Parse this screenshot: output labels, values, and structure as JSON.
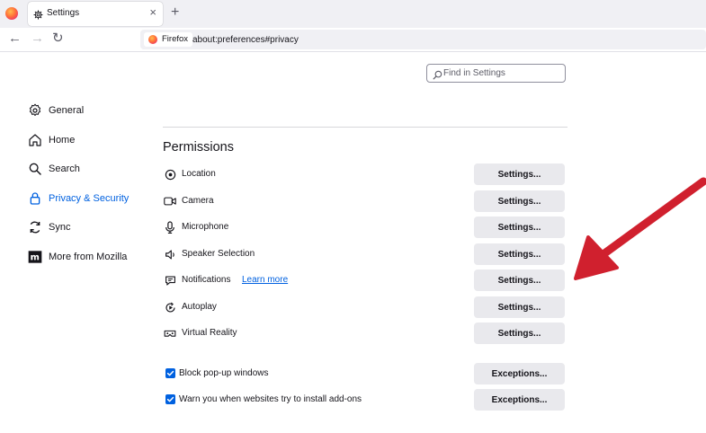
{
  "browser": {
    "tab": {
      "title": "Settings",
      "close_glyph": "×"
    },
    "new_tab_glyph": "+",
    "nav": {
      "back": "←",
      "forward": "→",
      "reload": "↻"
    },
    "identity_label": "Firefox",
    "url": "about:preferences#privacy"
  },
  "search": {
    "placeholder": "Find in Settings",
    "value": ""
  },
  "sidebar": {
    "items": [
      {
        "label": "General",
        "icon": "gear-icon",
        "selected": false
      },
      {
        "label": "Home",
        "icon": "home-icon",
        "selected": false
      },
      {
        "label": "Search",
        "icon": "search-icon",
        "selected": false
      },
      {
        "label": "Privacy & Security",
        "icon": "lock-icon",
        "selected": true
      },
      {
        "label": "Sync",
        "icon": "sync-icon",
        "selected": false
      },
      {
        "label": "More from Mozilla",
        "icon": "mozilla-icon",
        "selected": false
      }
    ]
  },
  "permissions": {
    "title": "Permissions",
    "rows": [
      {
        "label": "Location",
        "icon": "location-icon",
        "button": "Settings..."
      },
      {
        "label": "Camera",
        "icon": "camera-icon",
        "button": "Settings..."
      },
      {
        "label": "Microphone",
        "icon": "microphone-icon",
        "button": "Settings..."
      },
      {
        "label": "Speaker Selection",
        "icon": "speaker-icon",
        "button": "Settings..."
      },
      {
        "label": "Notifications",
        "icon": "notification-icon",
        "button": "Settings...",
        "link": "Learn more"
      },
      {
        "label": "Autoplay",
        "icon": "autoplay-icon",
        "button": "Settings..."
      },
      {
        "label": "Virtual Reality",
        "icon": "vr-icon",
        "button": "Settings..."
      }
    ],
    "checkboxes": [
      {
        "label": "Block pop-up windows",
        "checked": true,
        "button": "Exceptions..."
      },
      {
        "label": "Warn you when websites try to install add-ons",
        "checked": true,
        "button": "Exceptions..."
      }
    ]
  },
  "colors": {
    "accent": "#0061e0",
    "annotation_arrow": "#d0202e",
    "button_bg": "#e9e9ed"
  }
}
